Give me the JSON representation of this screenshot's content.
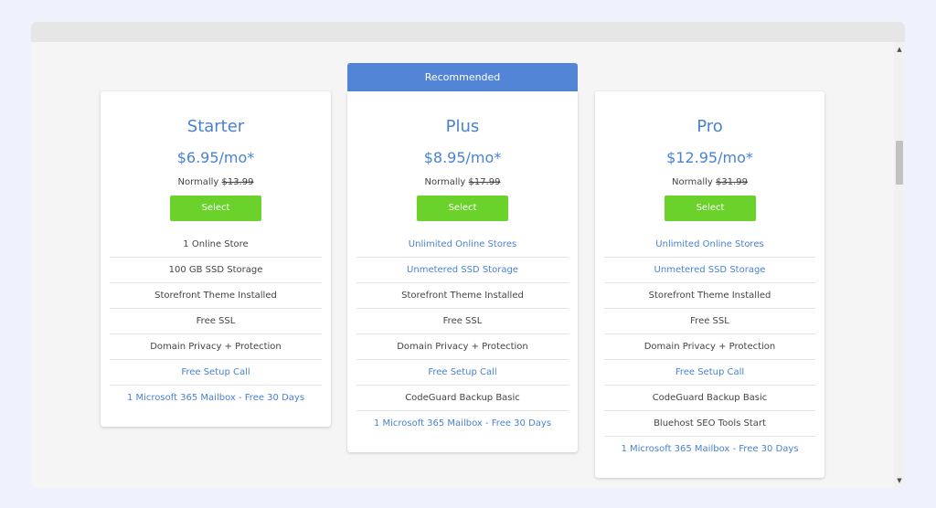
{
  "badge": {
    "label": "Recommended"
  },
  "plans": [
    {
      "name": "Starter",
      "price": "$6.95/mo*",
      "normally_label": "Normally ",
      "old_price": "$13.99",
      "select_label": "Select",
      "features": [
        {
          "text": "1 Online Store",
          "link": false
        },
        {
          "text": "100 GB SSD Storage",
          "link": false
        },
        {
          "text": "Storefront Theme Installed",
          "link": false
        },
        {
          "text": "Free SSL",
          "link": false
        },
        {
          "text": "Domain Privacy + Protection",
          "link": false
        },
        {
          "text": "Free Setup Call",
          "link": true
        },
        {
          "text": "1 Microsoft 365 Mailbox - Free 30 Days",
          "link": true
        }
      ]
    },
    {
      "name": "Plus",
      "price": "$8.95/mo*",
      "normally_label": "Normally ",
      "old_price": "$17.99",
      "select_label": "Select",
      "features": [
        {
          "text": "Unlimited Online Stores",
          "link": true
        },
        {
          "text": "Unmetered SSD Storage",
          "link": true
        },
        {
          "text": "Storefront Theme Installed",
          "link": false
        },
        {
          "text": "Free SSL",
          "link": false
        },
        {
          "text": "Domain Privacy + Protection",
          "link": false
        },
        {
          "text": "Free Setup Call",
          "link": true
        },
        {
          "text": "CodeGuard Backup Basic",
          "link": false
        },
        {
          "text": "1 Microsoft 365 Mailbox - Free 30 Days",
          "link": true
        }
      ]
    },
    {
      "name": "Pro",
      "price": "$12.95/mo*",
      "normally_label": "Normally ",
      "old_price": "$31.99",
      "select_label": "Select",
      "features": [
        {
          "text": "Unlimited Online Stores",
          "link": true
        },
        {
          "text": "Unmetered SSD Storage",
          "link": true
        },
        {
          "text": "Storefront Theme Installed",
          "link": false
        },
        {
          "text": "Free SSL",
          "link": false
        },
        {
          "text": "Domain Privacy + Protection",
          "link": false
        },
        {
          "text": "Free Setup Call",
          "link": true
        },
        {
          "text": "CodeGuard Backup Basic",
          "link": false
        },
        {
          "text": "Bluehost SEO Tools Start",
          "link": false
        },
        {
          "text": "1 Microsoft 365 Mailbox - Free 30 Days",
          "link": true
        }
      ]
    }
  ],
  "scrollbar": {
    "up_icon": "triangle-up-icon",
    "down_icon": "triangle-down-icon"
  }
}
